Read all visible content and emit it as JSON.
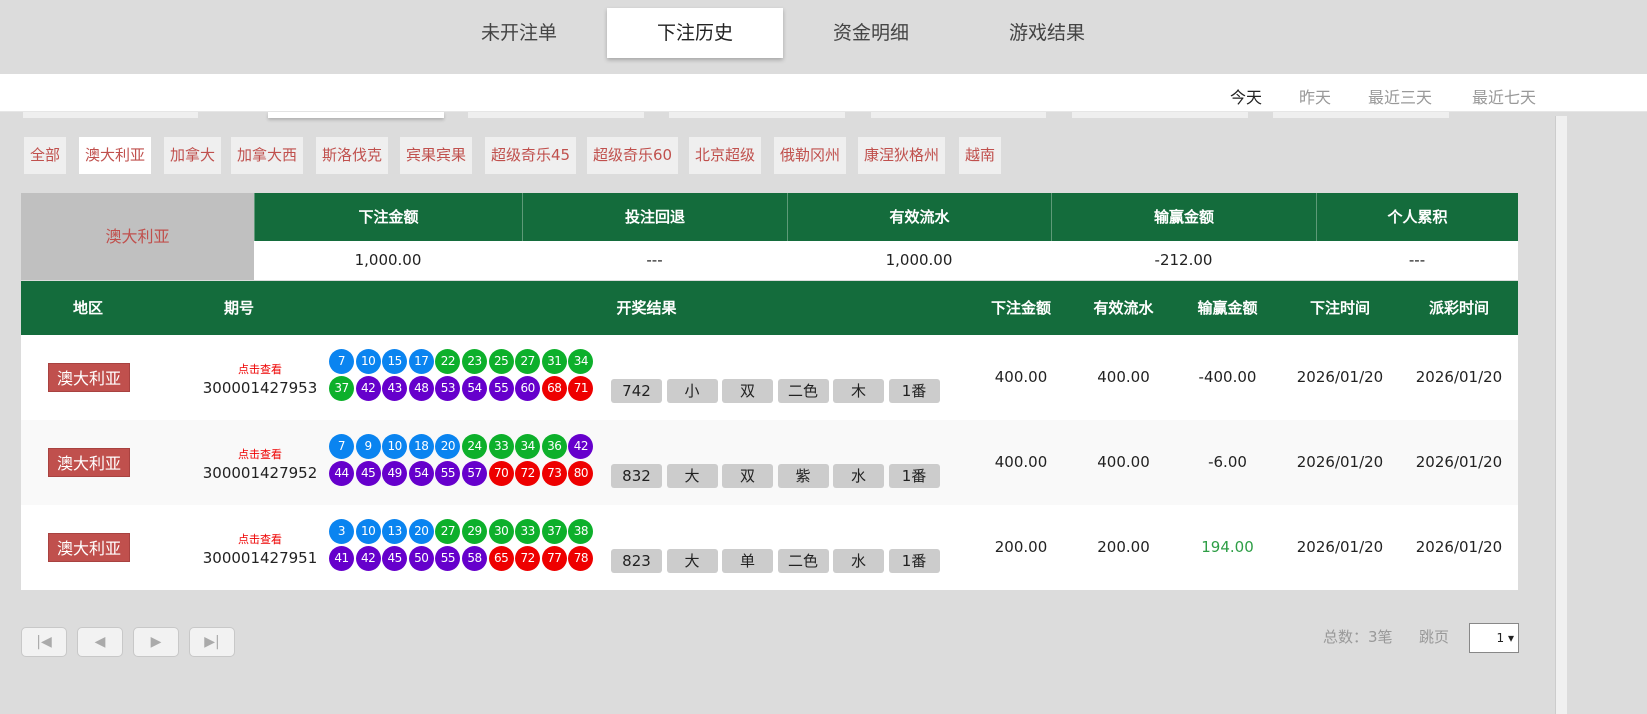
{
  "tabs": [
    {
      "label": "未开注单"
    },
    {
      "label": "下注历史",
      "active": true
    },
    {
      "label": "资金明细"
    },
    {
      "label": "游戏结果"
    }
  ],
  "date_filters": [
    {
      "label": "今天",
      "active": true
    },
    {
      "label": "昨天"
    },
    {
      "label": "最近三天"
    },
    {
      "label": "最近七天"
    }
  ],
  "regions": [
    {
      "label": "全部"
    },
    {
      "label": "澳大利亚",
      "active": true
    },
    {
      "label": "加拿大"
    },
    {
      "label": "加拿大西"
    },
    {
      "label": "斯洛伐克"
    },
    {
      "label": "宾果宾果"
    },
    {
      "label": "超级奇乐45"
    },
    {
      "label": "超级奇乐60"
    },
    {
      "label": "北京超级"
    },
    {
      "label": "俄勒冈州"
    },
    {
      "label": "康涅狄格州"
    },
    {
      "label": "越南"
    }
  ],
  "summary": {
    "region": "澳大利亚",
    "headers": [
      "下注金额",
      "投注回退",
      "有效流水",
      "输赢金额",
      "个人累积"
    ],
    "values": [
      "1,000.00",
      "---",
      "1,000.00",
      "-212.00",
      "---"
    ]
  },
  "table": {
    "headers": [
      "地区",
      "期号",
      "开奖结果",
      "下注金额",
      "有效流水",
      "输赢金额",
      "下注时间",
      "派彩时间"
    ],
    "view_label": "点击查看",
    "rows": [
      {
        "region": "澳大利亚",
        "issue": "300001427953",
        "balls": [
          7,
          10,
          15,
          17,
          22,
          23,
          25,
          27,
          31,
          34,
          37,
          42,
          43,
          48,
          53,
          54,
          55,
          60,
          68,
          71
        ],
        "tags": [
          "742",
          "小",
          "双",
          "二色",
          "木",
          "1番"
        ],
        "bet": "400.00",
        "valid": "400.00",
        "winloss": "-400.00",
        "bet_time": "2026/01/20",
        "payout_time": "2026/01/20"
      },
      {
        "region": "澳大利亚",
        "issue": "300001427952",
        "balls": [
          7,
          9,
          10,
          18,
          20,
          24,
          33,
          34,
          36,
          42,
          44,
          45,
          49,
          54,
          55,
          57,
          70,
          72,
          73,
          80
        ],
        "tags": [
          "832",
          "大",
          "双",
          "紫",
          "水",
          "1番"
        ],
        "bet": "400.00",
        "valid": "400.00",
        "winloss": "-6.00",
        "bet_time": "2026/01/20",
        "payout_time": "2026/01/20"
      },
      {
        "region": "澳大利亚",
        "issue": "300001427951",
        "balls": [
          3,
          10,
          13,
          20,
          27,
          29,
          30,
          33,
          37,
          38,
          41,
          42,
          45,
          50,
          55,
          58,
          65,
          72,
          77,
          78
        ],
        "tags": [
          "823",
          "大",
          "单",
          "二色",
          "水",
          "1番"
        ],
        "bet": "200.00",
        "valid": "200.00",
        "winloss": "194.00",
        "bet_time": "2026/01/20",
        "payout_time": "2026/01/20"
      }
    ]
  },
  "pagination": {
    "total_label": "总数：3笔",
    "jump_label": "跳页",
    "page": "1",
    "icons": [
      "first-page-icon",
      "prev-page-icon",
      "next-page-icon",
      "last-page-icon"
    ]
  },
  "colors": {
    "header_green": "#146c3c",
    "region_red": "#c0504d",
    "ball_blue": "#0a84f0",
    "ball_green": "#0db02b",
    "ball_purple": "#6600cc",
    "ball_red": "#ee0000",
    "win_green": "#2e9e46"
  }
}
